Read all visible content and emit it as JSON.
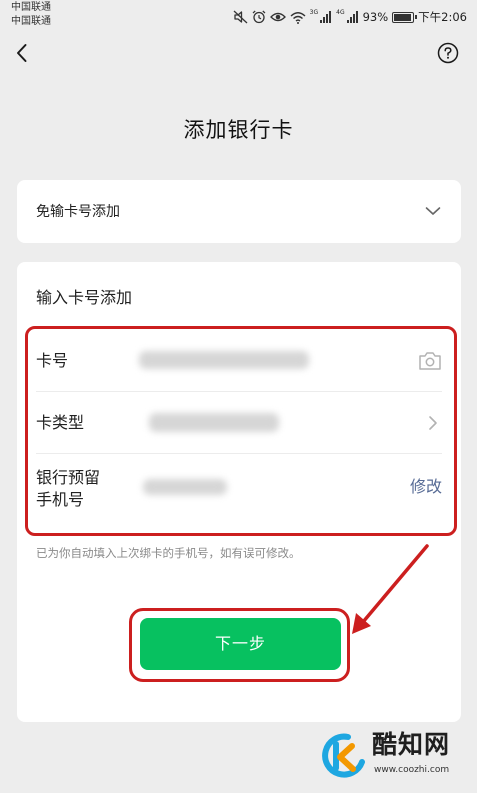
{
  "status_bar": {
    "carrier_1": "中国联通",
    "carrier_2": "中国联通",
    "net_1": "3G",
    "net_2": "4G",
    "battery": "93%",
    "time": "下午2:06"
  },
  "nav": {
    "back_icon": "chevron-left-icon",
    "help_icon": "question-circle-icon"
  },
  "title": "添加银行卡",
  "quick_add": {
    "label": "免输卡号添加",
    "icon": "chevron-down-icon"
  },
  "manual": {
    "section_title": "输入卡号添加",
    "card_number_label": "卡号",
    "card_type_label": "卡类型",
    "phone_label_line1": "银行预留",
    "phone_label_line2": "手机号",
    "modify_label": "修改",
    "hint": "已为你自动填入上次绑卡的手机号，如有误可修改。",
    "next_button": "下一步"
  },
  "watermark": {
    "title": "酷知网",
    "url": "www.coozhi.com"
  },
  "colors": {
    "primary": "#07c160",
    "link": "#576b95",
    "annotation": "#cc1f1f",
    "background": "#ededed"
  }
}
